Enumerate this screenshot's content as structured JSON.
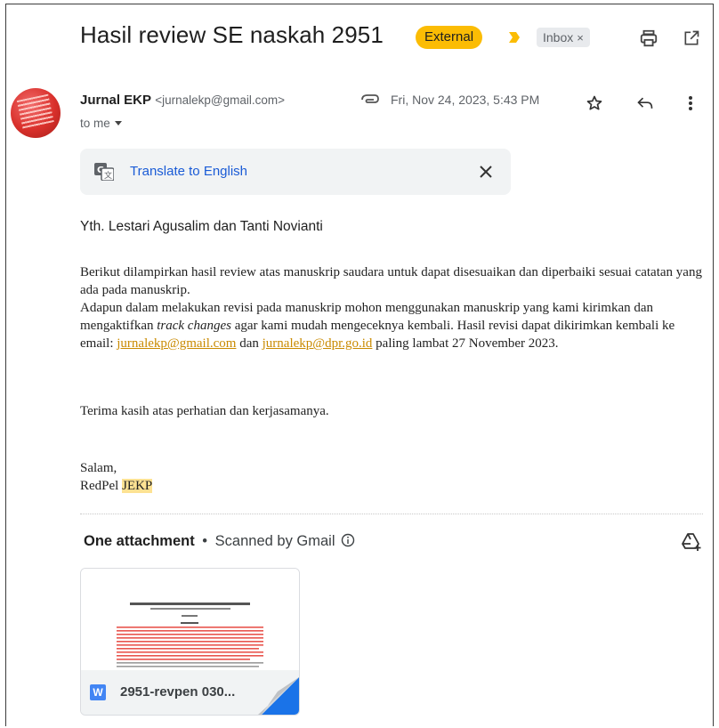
{
  "email": {
    "subject": "Hasil review SE naskah 2951",
    "labels": {
      "external": "External",
      "inbox": "Inbox",
      "inbox_remove": "×"
    },
    "sender": {
      "name": "Jurnal EKP",
      "address": "<jurnalekp@gmail.com>",
      "recipient_label": "to me"
    },
    "date": "Fri, Nov 24, 2023, 5:43 PM",
    "translate": {
      "label": "Translate to English"
    },
    "body": {
      "greeting": "Yth. Lestari Agusalim dan Tanti Novianti",
      "p1": "Berikut dilampirkan hasil review atas manuskrip saudara untuk dapat disesuaikan dan diperbaiki sesuai catatan yang ada pada manuskrip.",
      "p2_a": "Adapun dalam melakukan revisi pada manuskrip mohon menggunakan manuskrip yang kami kirimkan dan mengaktifkan ",
      "p2_italic": "track changes",
      "p2_b": " agar kami mudah mengeceknya kembali. Hasil revisi dapat dikirimkan kembali ke email: ",
      "email1": "jurnalekp@gmail.com",
      "p2_c": " dan ",
      "email2": "jurnalekp@dpr.go.id",
      "p2_d": " paling lambat 27 November 2023.",
      "thanks": "Terima kasih atas perhatian dan kerjasamanya.",
      "closing": "Salam,",
      "signature_prefix": "RedPel ",
      "signature_hl": "JEKP"
    },
    "attachments": {
      "header_count": "One attachment",
      "separator": "•",
      "header_scan": "Scanned by Gmail",
      "file_name": "2951-revpen 030...",
      "file_type_letter": "W"
    }
  },
  "colors": {
    "external_badge": "#fbbc04",
    "link": "#1155cc",
    "highlight": "#fde293",
    "word_blue": "#4285f4"
  }
}
